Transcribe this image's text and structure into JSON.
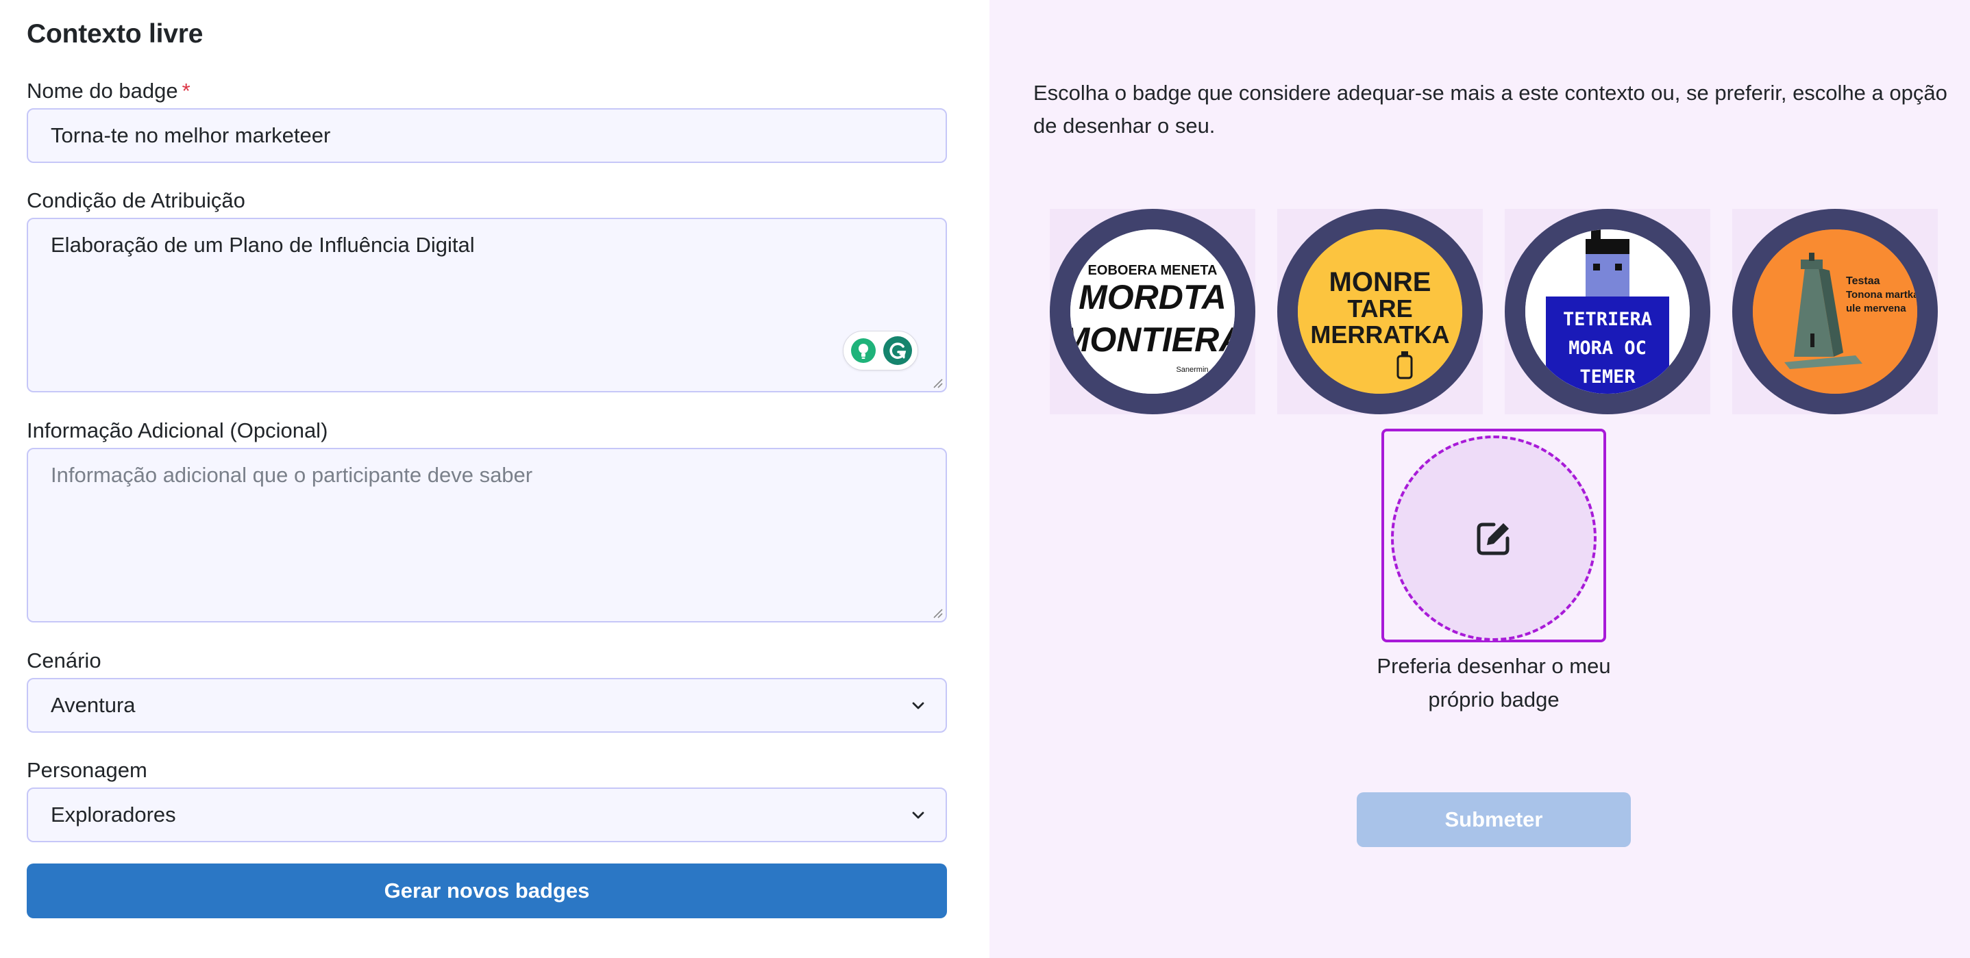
{
  "form": {
    "title": "Contexto livre",
    "badge_name": {
      "label": "Nome do badge",
      "required_mark": "*",
      "value": "Torna-te no melhor marketeer"
    },
    "attribution_condition": {
      "label": "Condição de Atribuição",
      "value": "Elaboração de um Plano de Influência Digital"
    },
    "additional_info": {
      "label": "Informação Adicional (Opcional)",
      "placeholder": "Informação adicional que o participante deve saber"
    },
    "scenario": {
      "label": "Cenário",
      "selected": "Aventura"
    },
    "character": {
      "label": "Personagem",
      "selected": "Exploradores"
    },
    "generate_button": "Gerar novos badges"
  },
  "selector": {
    "intro": "Escolha o badge que considere adequar-se mais a este contexto ou, se preferir, escolhe a opção de desenhar o seu.",
    "badges": [
      {
        "name": "badge-1",
        "bg_color": "#ffffff",
        "text_lines": [
          "EOBOERA MENETA",
          "MORDTA",
          "MONTIERA",
          "Sanermin"
        ]
      },
      {
        "name": "badge-2",
        "bg_color": "#fcc43f",
        "text_lines": [
          "MONRE",
          "TARE",
          "MERRATKA"
        ]
      },
      {
        "name": "badge-3",
        "bg_color": "#1a1ab8",
        "text_lines": [
          "TETRIERA",
          "MORA OC",
          "TEMER"
        ]
      },
      {
        "name": "badge-4",
        "bg_color": "#f98b31",
        "text_lines": [
          "Testaa",
          "Tonona martka",
          "ule mervena"
        ]
      }
    ],
    "draw_option_caption": "Preferia desenhar o meu próprio badge",
    "submit_button": "Submeter"
  },
  "colors": {
    "accent": "#2b77c5",
    "draw_accent": "#a81ad8",
    "badge_ring": "#40426d",
    "right_panel_bg": "#f9f0fd",
    "submit_disabled": "#a9c3e9",
    "required": "#dc3545"
  },
  "icons": {
    "draw": "edit-square-icon",
    "select_arrow": "chevron-down-icon",
    "grammarly_bulb": "lightbulb-icon",
    "grammarly_logo": "grammarly-g-icon"
  }
}
